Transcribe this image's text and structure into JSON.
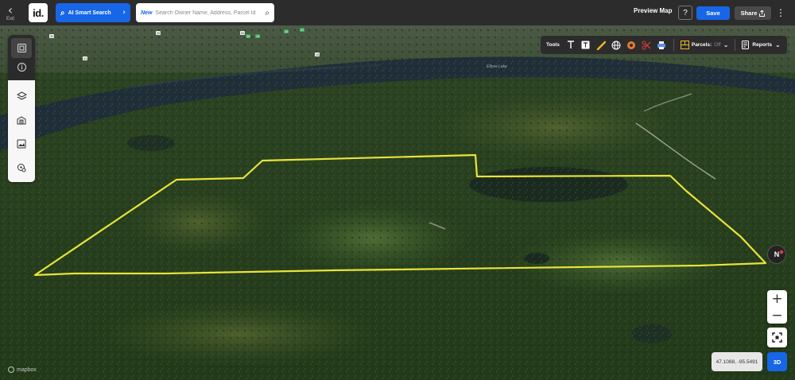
{
  "topbar": {
    "exit_label": "Exit",
    "logo_text": "id.",
    "ai_search_label": "AI Smart Search",
    "search_new_badge": "New",
    "search_placeholder": "Search Owner Name, Address, Parcel Id",
    "preview_label": "Preview Map",
    "help_label": "?",
    "save_label": "Save",
    "share_label": "Share"
  },
  "sidebar": {
    "top_items": [
      {
        "icon": "map-panel-icon"
      },
      {
        "icon": "info-icon"
      }
    ],
    "bottom_items": [
      {
        "icon": "layers-icon"
      },
      {
        "icon": "buildings-icon"
      },
      {
        "icon": "image-overlay-icon"
      },
      {
        "icon": "location-settings-icon"
      }
    ]
  },
  "tools": {
    "label": "Tools",
    "parcels_label": "Parcels:",
    "parcels_value": "Off",
    "reports_label": "Reports"
  },
  "map": {
    "lake_label": "Elbow Lake",
    "coords": "47.1088, -95.5491",
    "compass_label": "N",
    "mode_label": "3D",
    "attribution": "mapbox",
    "boundary_color": "#e8e33a",
    "road_labels": [
      "35",
      "39",
      "55",
      "16",
      "18",
      "26",
      "52",
      "41",
      "18"
    ]
  },
  "colors": {
    "accent": "#1766e8",
    "toolbar_bg": "#2c2c2c"
  }
}
